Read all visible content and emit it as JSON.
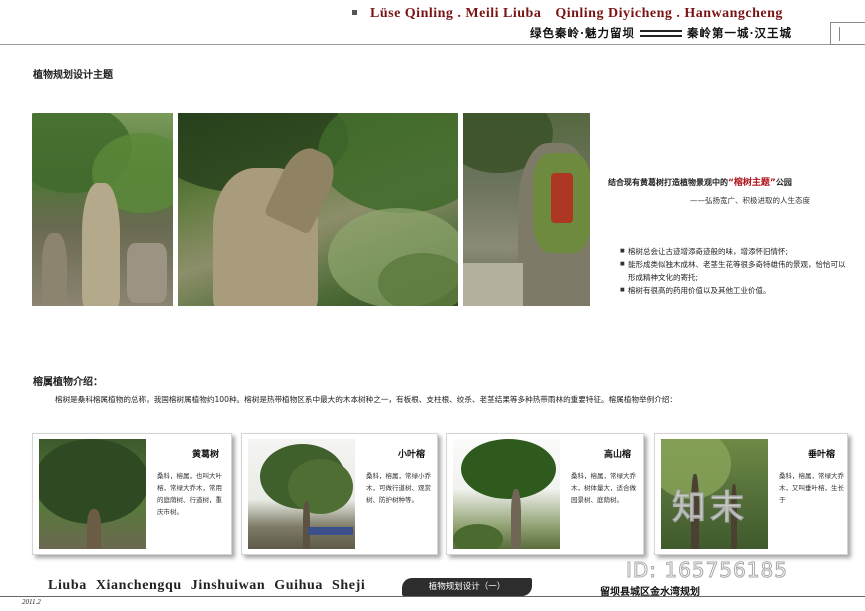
{
  "header": {
    "title_en_part1": "Lüse  Qinling . Meili Liuba",
    "title_en_part2": "Qinling Diyicheng . Hanwangcheng",
    "title_cn_left": "绿色秦岭·魅力留坝",
    "title_cn_right": "秦岭第一城·汉王城"
  },
  "section_title": "植物规划设计主题",
  "intro": {
    "line1_prefix": "结合现有黄葛树打造植物景观中的",
    "line1_highlight": "“榕树主题”",
    "line1_suffix": "公园",
    "line2": "——弘扬宽广、积极进取的人生态度",
    "bullets": [
      "榕树总会让古迹增添奇迹般的味，增添怀旧情怀;",
      "能形成类似独木成林、老茎生花等很多奇特雄伟的景观，恰恰可以形成精神文化的寄托;",
      "榕树有很高的药用价值以及其他工业价值。"
    ]
  },
  "plant_intro": {
    "title": "榕属植物介绍：",
    "paragraph": "榕树是桑科榕属植物的总称，我国榕树属植物约100种。榕树是热带植物区系中最大的木本树种之一，有板根、支柱根、绞杀、老茎结果等多种热带雨林的重要特征。榕属植物举例介绍："
  },
  "cards": [
    {
      "name": "黄葛树",
      "desc": "桑科，榕属，也叫大叶榕，常绿大乔木，常用的庭荫树、行道树，重庆市树。"
    },
    {
      "name": "小叶榕",
      "desc": "桑科，榕属，常绿小乔木，可做行道树、观赏树、防护树种等。"
    },
    {
      "name": "高山榕",
      "desc": "桑科，榕属，常绿大乔木，树体量大，适合做园景树、庭荫树。"
    },
    {
      "name": "垂叶榕",
      "desc": "桑科，榕属，常绿大乔木，又叫垂叶榕，生长于"
    }
  ],
  "footer": {
    "title_en_1": "Liuba",
    "title_en_2": "Xianchengqu",
    "title_en_3": "Jinshuiwan",
    "title_en_4": "Guihua",
    "title_en_5": "Sheji",
    "tag": "植物规划设计（一）",
    "right_text": "留坝县城区金水湾规划",
    "date": "2011.2"
  },
  "watermark": {
    "logo": "知末",
    "id": "ID: 165756185"
  }
}
